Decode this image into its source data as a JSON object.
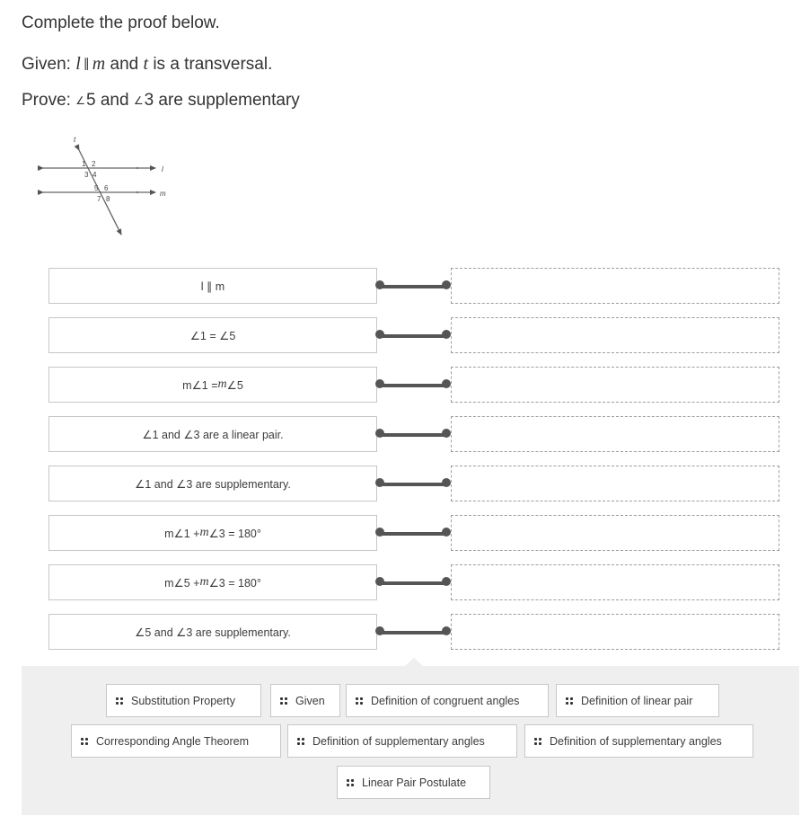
{
  "question": {
    "title": "Complete the proof below.",
    "given_prefix": "Given: ",
    "given_l": "l",
    "given_parallel": "∥",
    "given_m": "m",
    "given_mid": " and ",
    "given_t": "t",
    "given_suffix": " is a transversal.",
    "prove_prefix": "Prove: ",
    "prove_angle_a": "5",
    "prove_mid": " and ",
    "prove_angle_b": "3",
    "prove_suffix": " are supplementary",
    "angle_symbol": "∠"
  },
  "diagram": {
    "line_labels": {
      "transversal": "t",
      "top": "l",
      "bottom": "m"
    },
    "angle_labels": [
      "1",
      "2",
      "3",
      "4",
      "5",
      "6",
      "7",
      "8"
    ]
  },
  "proof": {
    "statements": [
      {
        "parts": [
          {
            "t": "l ∥ m"
          }
        ]
      },
      {
        "parts": [
          {
            "t": "∠1 = ∠5"
          }
        ]
      },
      {
        "parts": [
          {
            "t": "m∠1 = "
          },
          {
            "t": "m",
            "i": true
          },
          {
            "t": "∠5"
          }
        ]
      },
      {
        "parts": [
          {
            "t": "∠1 and ∠3 are a linear pair."
          }
        ]
      },
      {
        "parts": [
          {
            "t": "∠1 and ∠3 are supplementary."
          }
        ]
      },
      {
        "parts": [
          {
            "t": "m∠1 + "
          },
          {
            "t": "m",
            "i": true
          },
          {
            "t": "∠3 = 180°"
          }
        ]
      },
      {
        "parts": [
          {
            "t": "m∠5 + "
          },
          {
            "t": "m",
            "i": true
          },
          {
            "t": "∠3 = 180°"
          }
        ]
      },
      {
        "parts": [
          {
            "t": "∠5 and ∠3 are supplementary."
          }
        ]
      }
    ],
    "reasons": [
      "",
      "",
      "",
      "",
      "",
      "",
      "",
      ""
    ]
  },
  "choices": [
    "Substitution Property",
    "Given",
    "Definition of congruent angles",
    "Definition of linear pair",
    "Corresponding Angle Theorem",
    "Definition of supplementary angles",
    "Definition of supplementary angles",
    "Linear Pair Postulate"
  ],
  "colors": {
    "connector": "#555555",
    "tray_background": "#efefef",
    "drop_border": "#9e9e9e"
  }
}
